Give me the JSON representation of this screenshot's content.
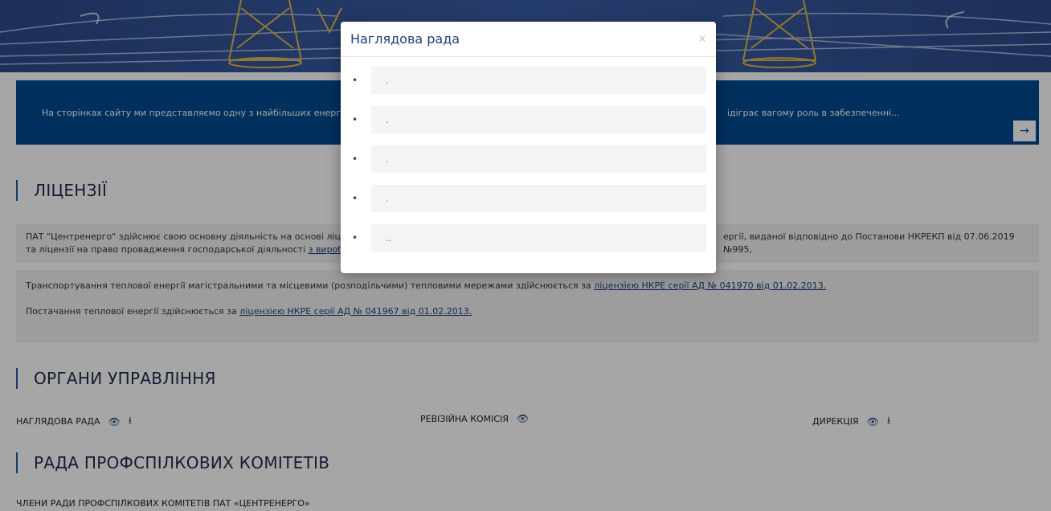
{
  "intro": {
    "text_left": "На сторінках сайту ми представляємо одну з найбільших енергоге",
    "text_right": "ідіграє вагому роль в забезпеченні...",
    "arrow": "→"
  },
  "licenses": {
    "heading": "ЛІЦЕНЗІЇ",
    "p1_line1_left": "ПАТ \"Центренерго\" здійснює свою основну діяльність на основі ліце",
    "p1_line1_right": "ергії, виданої відповідно до Постанови НКРЕКП від 07.06.2019 №995,",
    "p1_line2": "та ліцензії на право провадження господарської діяльності ",
    "p1_link": "з виробни",
    "p2_text": "Транспортування теплової енергії магістральними та місцевими (розподільчими) тепловими мережами здійснюється за ",
    "p2_link": "ліцензією НКРЕ серії АД № 041970 від 01.02.2013.",
    "p3_text": "Постачання теплової енергії здійснюється за ",
    "p3_link": "ліцензією НКРЕ серії АД № 041967 від 01.02.2013."
  },
  "governance": {
    "heading": "ОРГАНИ УПРАВЛІННЯ",
    "items": [
      {
        "label": "НАГЛЯДОВА РАДА",
        "icons": [
          "eye-icon",
          "download-icon"
        ]
      },
      {
        "label": "РЕВІЗІЙНА КОМІСІЯ",
        "icons": [
          "eye-icon"
        ]
      },
      {
        "label": "ДИРЕКЦІЯ",
        "icons": [
          "eye-icon",
          "download-icon"
        ]
      }
    ],
    "eye_glyph": "👁",
    "download_glyph": "⭳"
  },
  "unions": {
    "heading": "РАДА ПРОФСПІЛКОВИХ КОМІТЕТІВ",
    "members_label": "ЧЛЕНИ РАДИ ПРОФСПІЛКОВИХ КОМІТЕТІВ ПАТ «ЦЕНТРЕНЕРГО»"
  },
  "modal": {
    "title": "Наглядова рада",
    "close": "×",
    "items": [
      ".",
      ".",
      ".",
      ".",
      ".."
    ]
  }
}
